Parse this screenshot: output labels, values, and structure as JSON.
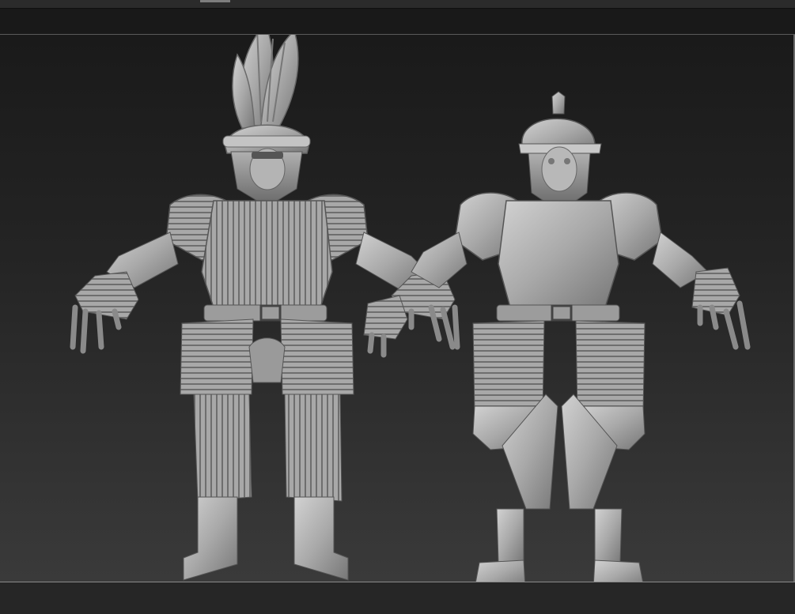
{
  "app": {
    "viewport_label": "",
    "background_color": "#1d1d1d",
    "model_color": "#b8b8b8"
  },
  "viewport": {
    "models": [
      {
        "id": "armored-knight-plumed",
        "description_icon": "knight-figure-icon"
      },
      {
        "id": "armored-soldier-helmet",
        "description_icon": "soldier-figure-icon"
      }
    ]
  }
}
